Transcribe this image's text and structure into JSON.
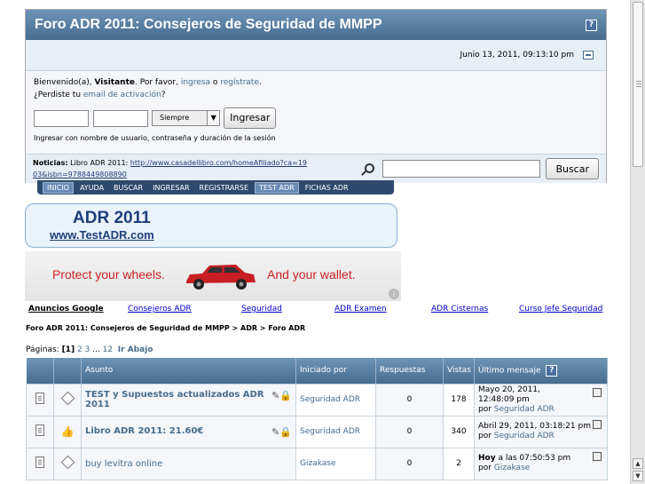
{
  "header": {
    "title": "Foro ADR 2011: Consejeros de Seguridad de MMPP",
    "help_label": "?",
    "datetime": "Junio 13, 2011, 09:13:10 pm"
  },
  "user": {
    "welcome_prefix": "Bienvenido(a), ",
    "visitor": "Visitante",
    "please": ". Por favor, ",
    "login_link": "ingresa",
    "or": " o ",
    "register_link": "regístrate",
    "period": ".",
    "lost_prefix": "¿Perdiste tu ",
    "activation_link": "email de activación",
    "lost_suffix": "?",
    "duration_option": "Siempre",
    "login_button": "Ingresar",
    "session_hint": "Ingresar con nombre de usuario, contraseña y duración de la sesión"
  },
  "news": {
    "label": "Noticias:",
    "text": " Libro ADR 2011: ",
    "link": "http://www.casadellibro.com/homeAfiliado?ca=1903&isbn=9788449808890"
  },
  "search": {
    "button": "Buscar",
    "value": ""
  },
  "menu": {
    "items": [
      "INICIO",
      "AYUDA",
      "BUSCAR",
      "INGRESAR",
      "REGISTRARSE",
      "TEST ADR",
      "FICHAS ADR"
    ]
  },
  "banner": {
    "title": "ADR 2011",
    "url": "www.TestADR.com"
  },
  "ad": {
    "left_text": "Protect your wheels.",
    "right_text": "And your wallet.",
    "info": "i"
  },
  "link_units": {
    "label": "Anuncios Google",
    "links": [
      "Consejeros ADR",
      "Seguridad",
      "ADR Examen",
      "ADR Cisternas",
      "Curso Jefe Seguridad"
    ]
  },
  "breadcrumb": "Foro ADR 2011: Consejeros de Seguridad de MMPP > ADR > Foro ADR",
  "pages": {
    "label": "Páginas: ",
    "current": "[1]",
    "p2": "2",
    "p3": "3",
    "ellipsis": " ... ",
    "p12": "12",
    "go_down": "Ir Abajo"
  },
  "table": {
    "headers": {
      "subject": "Asunto",
      "started_by": "Iniciado por",
      "replies": "Respuestas",
      "views": "Vistas",
      "last_post": "Último mensaje"
    },
    "rows": [
      {
        "subject": "TEST y Supuestos actualizados ADR 2011",
        "starter": "Seguridad ADR",
        "replies": "0",
        "views": "178",
        "last_date": "Mayo 20, 2011, 12:48:09 pm",
        "last_by_prefix": "por ",
        "last_by": "Seguridad ADR"
      },
      {
        "subject": "Libro ADR 2011: 21.60€",
        "starter": "Seguridad ADR",
        "replies": "0",
        "views": "340",
        "last_date": "Abril 29, 2011, 03:18:21 pm",
        "last_by_prefix": "por ",
        "last_by": "Seguridad ADR"
      },
      {
        "subject": "buy levitra online",
        "starter": "Gizakase",
        "replies": "0",
        "views": "2",
        "last_date_bold": "Hoy",
        "last_date_rest": " a las 07:50:53 pm",
        "last_by_prefix": "por ",
        "last_by": "Gizakase"
      }
    ]
  },
  "colors": {
    "header_blue": "#476C8E",
    "panel_bg": "#E7EEF5",
    "menu_bg": "#2D4A6E",
    "ad_red": "#CC2222"
  }
}
